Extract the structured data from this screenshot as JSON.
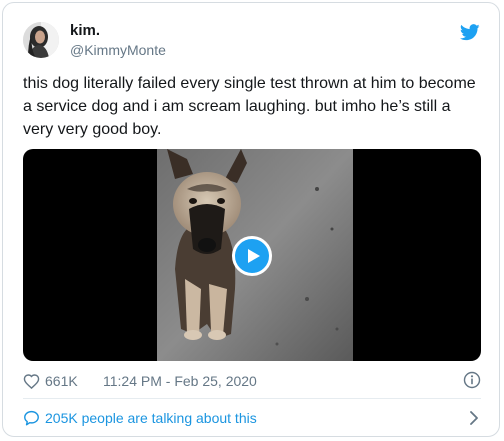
{
  "author": {
    "display_name": "kim.",
    "handle": "@KimmyMonte",
    "avatar_icon": "profile-photo"
  },
  "tweet": {
    "text": "this dog literally failed every single test thrown at him to become a service dog and i am scream laughing. but imho he’s still a very very good boy."
  },
  "media": {
    "type": "video",
    "play_icon": "play-icon"
  },
  "meta": {
    "likes": "661K",
    "timestamp": "11:24 PM - Feb 25, 2020",
    "like_icon": "heart-icon",
    "info_icon": "info-icon"
  },
  "conversation": {
    "label": "205K people are talking about this",
    "icon": "chat-bubble-icon",
    "chevron_icon": "chevron-right-icon"
  },
  "colors": {
    "brand_blue": "#1da1f2",
    "link_blue": "#1b95e0",
    "text_primary": "#14171a",
    "text_secondary": "#657786",
    "border": "#d6dce1"
  }
}
